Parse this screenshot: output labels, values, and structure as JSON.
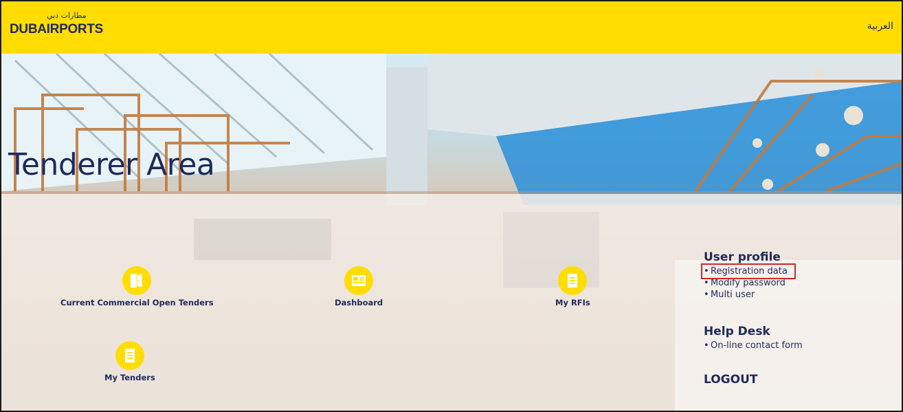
{
  "header": {
    "logo_arabic": "مطارات دبي",
    "logo_text": "DUBAIRPORTS",
    "language_link": "العربية",
    "background_color": "#ffdd00"
  },
  "page_title": "Tenderer Area",
  "tiles": [
    {
      "label": "Current Commercial Open Tenders",
      "icon": "door-icon"
    },
    {
      "label": "Dashboard",
      "icon": "dashboard-icon"
    },
    {
      "label": "My RFIs",
      "icon": "document-icon"
    },
    {
      "label": "My Tenders",
      "icon": "document-icon"
    }
  ],
  "user_profile": {
    "title": "User profile",
    "items": [
      "Registration data",
      "Modify password",
      "Multi user"
    ],
    "highlighted_item": "Registration data"
  },
  "help_desk": {
    "title": "Help Desk",
    "items": [
      "On-line contact form"
    ]
  },
  "logout_label": "LOGOUT",
  "colors": {
    "accent_yellow": "#ffdd00",
    "text_navy": "#1f2a5a",
    "highlight_red": "#cc2a2a"
  }
}
